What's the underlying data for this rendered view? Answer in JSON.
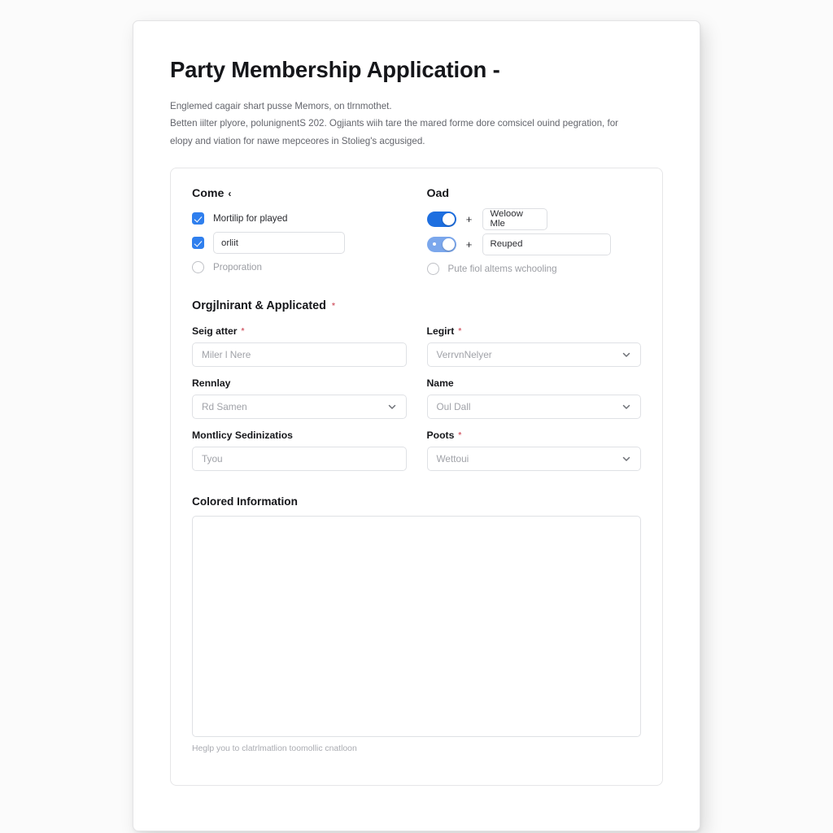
{
  "form": {
    "title": "Party Membership Application -",
    "intro_lines": [
      "Englemed cagair shart pusse Memors, on tlrnmothet.",
      "Betten iilter plyore, polunignentS 202. Ogjiants wiih tare the mared forme dore comsicel ouind pegration, for",
      "elopy and viation for nawe mepceores in Stolieg's acgusiged."
    ]
  },
  "left_group": {
    "heading": "Come",
    "heading_caret": "‹",
    "checkbox_option": {
      "label": "Mortilip for played",
      "checked": true
    },
    "checkbox_input_option": {
      "checked": true,
      "value": "orliit"
    },
    "radio_option": {
      "label": "Proporation",
      "selected": false
    }
  },
  "right_group": {
    "heading": "Oad",
    "toggle_rows": [
      {
        "state": "on",
        "plus": "+",
        "value": "Weloow Mle"
      },
      {
        "state": "half",
        "plus": "+",
        "value": "Reuped"
      }
    ],
    "radio_option": {
      "label": "Pute fiol altems wchooling",
      "selected": false
    }
  },
  "fields_section": {
    "heading": "Orgjlnirant & Applicated",
    "heading_required": "*",
    "rows": [
      {
        "left": {
          "label": "Seig atter",
          "required": "*",
          "type": "text",
          "placeholder": "Miler l Nere"
        },
        "right": {
          "label": "Legirt",
          "required": "*",
          "type": "select",
          "placeholder": "VerrvnNelyer"
        }
      },
      {
        "left": {
          "label": "Rennlay",
          "required": "",
          "type": "select",
          "placeholder": "Rd Samen"
        },
        "right": {
          "label": "Name",
          "required": "",
          "type": "select",
          "placeholder": "Oul Dall"
        }
      },
      {
        "left": {
          "label": "Montlicy Sedinizatios",
          "required": "",
          "type": "text",
          "placeholder": "Tyou"
        },
        "right": {
          "label": "Poots",
          "required": "*",
          "type": "select",
          "placeholder": "Wettoui"
        }
      }
    ]
  },
  "notes_section": {
    "heading": "Colored Information",
    "value": "",
    "help_text": "Heglp you to clatrlmatlion toomollic cnatloon"
  },
  "colors": {
    "accent_blue": "#2f7fee",
    "toggle_on": "#1e6fe0",
    "toggle_half": "#7ba7ec",
    "required_red": "#d4636f",
    "text_dark": "#16171b",
    "text_muted": "#9b9da3",
    "border": "#dfe1e5"
  }
}
